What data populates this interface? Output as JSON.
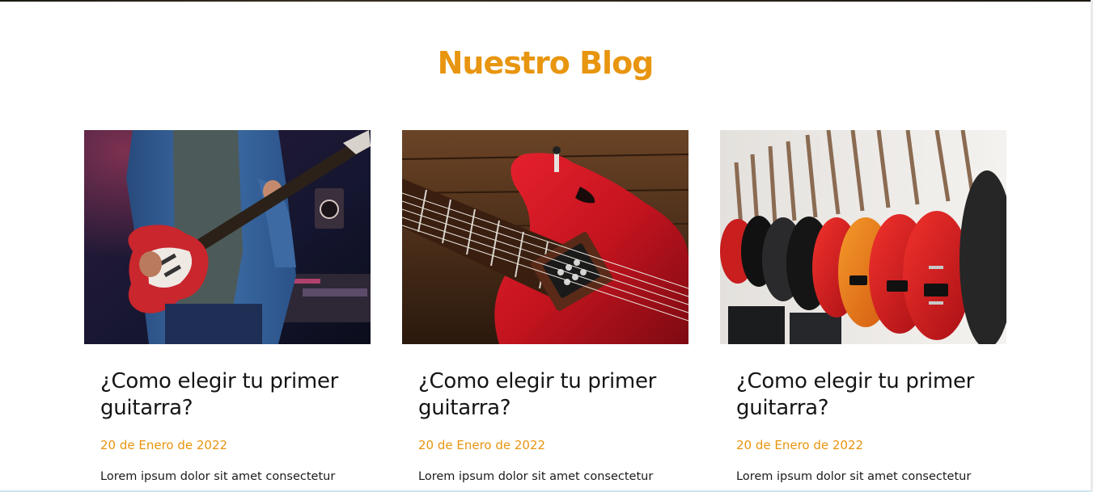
{
  "section": {
    "title": "Nuestro Blog"
  },
  "posts": [
    {
      "title": "¿Como elegir tu primer guitarra?",
      "date": "20 de Enero de 2022",
      "excerpt": "Lorem ipsum dolor sit amet consectetur",
      "image": "guitarist-red-strat-icon"
    },
    {
      "title": "¿Como elegir tu primer guitarra?",
      "date": "20 de Enero de 2022",
      "excerpt": "Lorem ipsum dolor sit amet consectetur",
      "image": "red-guitar-body-closeup-icon"
    },
    {
      "title": "¿Como elegir tu primer guitarra?",
      "date": "20 de Enero de 2022",
      "excerpt": "Lorem ipsum dolor sit amet consectetur",
      "image": "guitar-store-wall-icon"
    }
  ],
  "colors": {
    "accent": "#e8950f",
    "text": "#151515"
  }
}
